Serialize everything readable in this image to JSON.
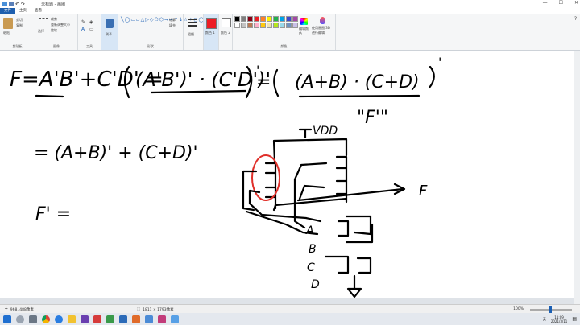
{
  "window": {
    "title": "未标题 - 画图",
    "minimize": "—",
    "maximize": "☐",
    "close": "✕"
  },
  "tabs": [
    {
      "label": "文件"
    },
    {
      "label": "主页"
    },
    {
      "label": "查看"
    }
  ],
  "ribbon": {
    "clipboard": {
      "paste": "粘贴",
      "cut": "剪切",
      "copy": "复制",
      "group": "剪贴板"
    },
    "image": {
      "crop": "裁剪",
      "resize": "重新调整大小",
      "rotate": "旋转",
      "select": "选择",
      "group": "图像"
    },
    "tools": {
      "group": "工具"
    },
    "brushes": {
      "label": "刷子"
    },
    "shapes": {
      "outline": "轮廓",
      "fill": "填充",
      "group": "形状"
    },
    "size": {
      "label": "粗细"
    },
    "color1": {
      "label": "颜色 1"
    },
    "color2": {
      "label": "颜色 2"
    },
    "colors": {
      "group": "颜色",
      "edit": "编辑颜色",
      "paint3d": "使用画图 3D 进行编辑"
    },
    "palette": [
      "#000000",
      "#7f7f7f",
      "#880015",
      "#ed1c24",
      "#ff7f27",
      "#fff200",
      "#22b14c",
      "#00a2e8",
      "#3f48cc",
      "#a349a4",
      "#ffffff",
      "#c3c3c3",
      "#b97a57",
      "#ffaec9",
      "#ffc90e",
      "#efe4b0",
      "#b5e61d",
      "#99d9ea",
      "#7092be",
      "#c8bfe7"
    ],
    "color1_value": "#ed1c24"
  },
  "status": {
    "cursor": "968, 488像素",
    "size": "1811 × 1793像素",
    "zoom": "100%"
  },
  "taskbar": {
    "time": "11:09",
    "date": "2021/3/11",
    "lang": "英"
  },
  "drawing": {
    "line1a": "F=A'B'+C'D' =",
    "line1b": "(A'B')' · (C'D')'",
    "line1c": "(A+B) · (C+D)",
    "fbar": "\"F'\"",
    "line2": "= (A+B)' + (C+D)'",
    "line3": "F' =",
    "vdd": "VDD",
    "out": "F",
    "inA": "A",
    "inB": "B",
    "inC": "C",
    "inD": "D"
  }
}
